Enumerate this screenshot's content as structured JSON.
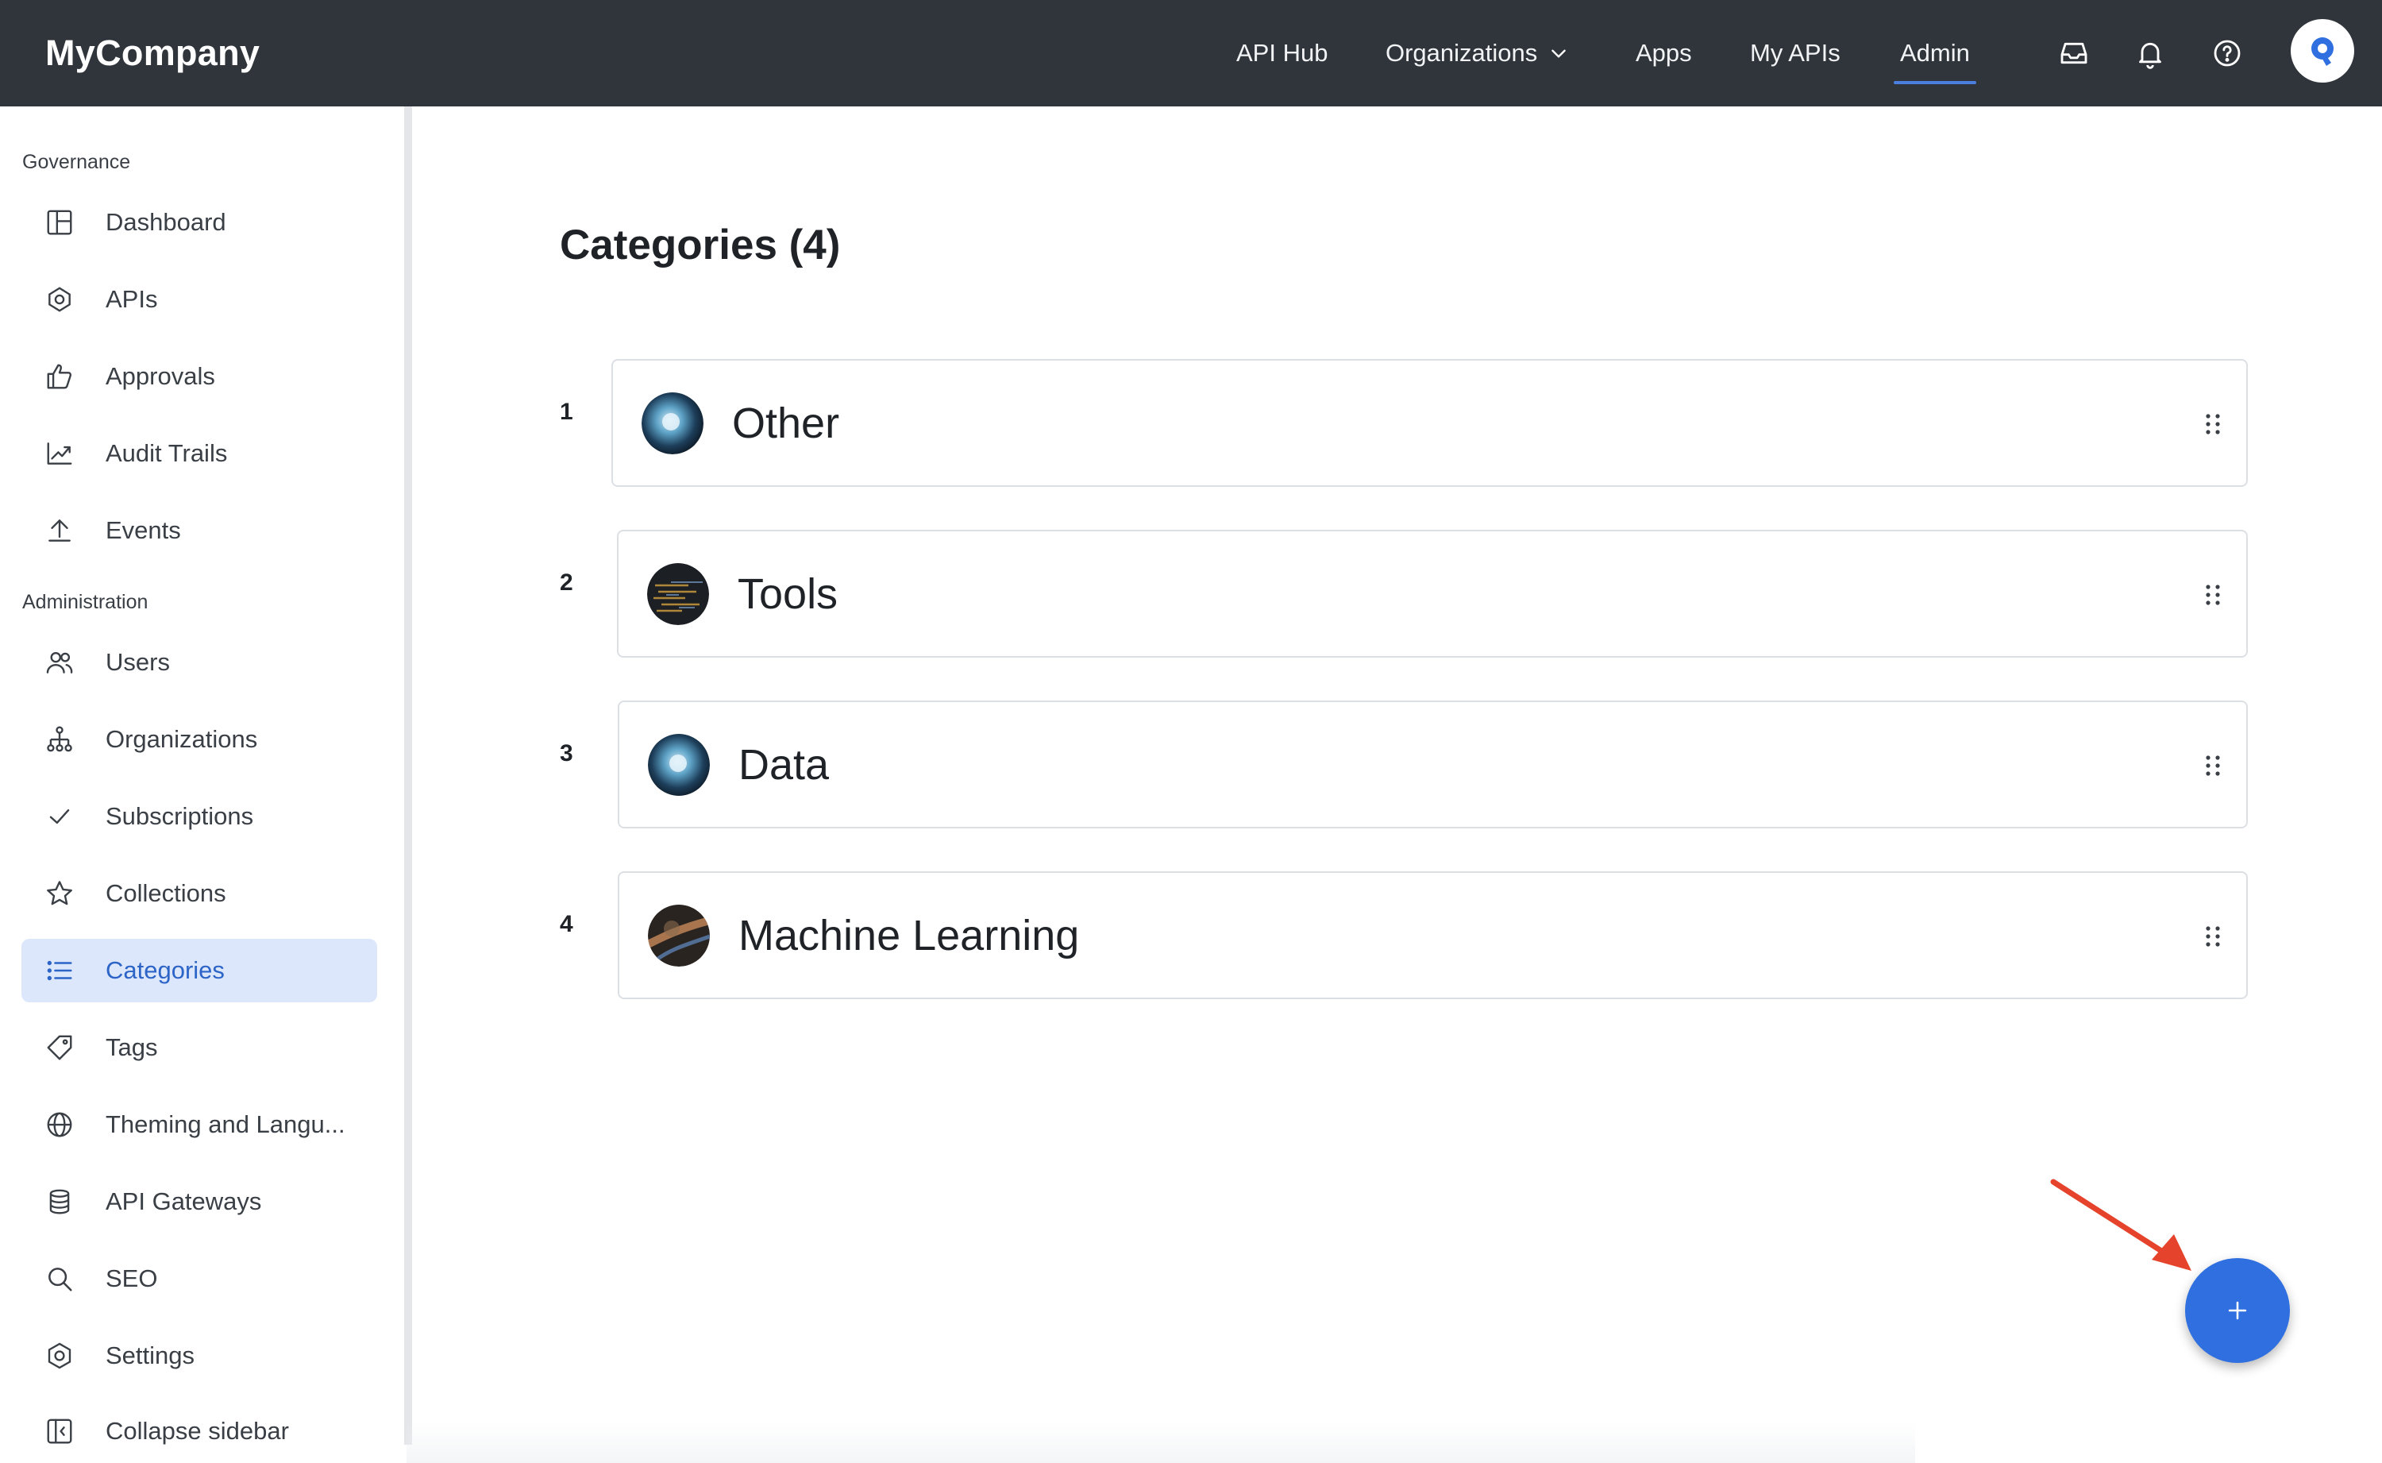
{
  "brand": "MyCompany",
  "topnav": {
    "items": [
      {
        "label": "API Hub"
      },
      {
        "label": "Organizations"
      },
      {
        "label": "Apps"
      },
      {
        "label": "My APIs"
      },
      {
        "label": "Admin",
        "active": true
      }
    ],
    "icons": [
      "inbox-icon",
      "bell-icon",
      "help-icon"
    ]
  },
  "sidebar": {
    "sections": [
      {
        "label": "Governance",
        "items": [
          {
            "label": "Dashboard",
            "icon": "dashboard-icon"
          },
          {
            "label": "APIs",
            "icon": "apis-icon"
          },
          {
            "label": "Approvals",
            "icon": "thumbs-up-icon"
          },
          {
            "label": "Audit Trails",
            "icon": "chart-line-icon"
          },
          {
            "label": "Events",
            "icon": "upload-icon"
          }
        ]
      },
      {
        "label": "Administration",
        "items": [
          {
            "label": "Users",
            "icon": "users-icon"
          },
          {
            "label": "Organizations",
            "icon": "org-tree-icon"
          },
          {
            "label": "Subscriptions",
            "icon": "check-icon"
          },
          {
            "label": "Collections",
            "icon": "star-icon"
          },
          {
            "label": "Categories",
            "icon": "list-icon",
            "active": true
          },
          {
            "label": "Tags",
            "icon": "tag-icon"
          },
          {
            "label": "Theming and Langu...",
            "icon": "globe-icon"
          },
          {
            "label": "API Gateways",
            "icon": "database-icon"
          },
          {
            "label": "SEO",
            "icon": "search-icon"
          },
          {
            "label": "Settings",
            "icon": "settings-icon"
          }
        ]
      }
    ],
    "collapse_label": "Collapse sidebar"
  },
  "main": {
    "title": "Categories (4)",
    "categories": [
      {
        "index": "1",
        "name": "Other"
      },
      {
        "index": "2",
        "name": "Tools"
      },
      {
        "index": "3",
        "name": "Data"
      },
      {
        "index": "4",
        "name": "Machine Learning"
      }
    ],
    "fab_icon": "plus-icon"
  },
  "colors": {
    "topbar": "#30353b",
    "accent": "#2f6fe0",
    "active_bg": "#dde7fb",
    "annotation_arrow": "#e5432b"
  }
}
